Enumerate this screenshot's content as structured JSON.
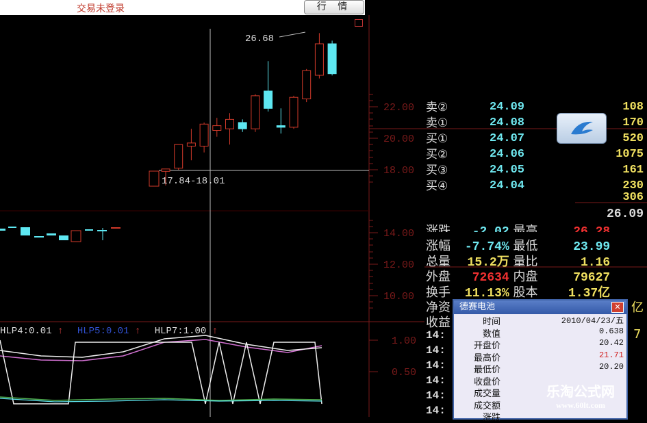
{
  "topbar": {
    "title": "交易未登录",
    "market_button": "行 情"
  },
  "price_chart": {
    "high_annotation": "26.68",
    "range_annotation": "17.84-18.01",
    "y_axis": [
      "22.00",
      "20.00",
      "18.00",
      "14.00",
      "12.00",
      "10.00"
    ],
    "candles": [
      {
        "o": 17.9,
        "c": 18.05,
        "h": 18.05,
        "l": 17.0
      },
      {
        "o": 18.1,
        "c": 19.6,
        "h": 19.6,
        "l": 18.0
      },
      {
        "o": 19.5,
        "c": 19.7,
        "h": 20.6,
        "l": 18.6
      },
      {
        "o": 19.5,
        "c": 20.9,
        "h": 21.0,
        "l": 19.1
      },
      {
        "o": 20.5,
        "c": 20.8,
        "h": 21.3,
        "l": 20.1
      },
      {
        "o": 20.6,
        "c": 21.2,
        "h": 21.6,
        "l": 19.6
      },
      {
        "o": 21.0,
        "c": 20.6,
        "h": 21.2,
        "l": 20.4
      },
      {
        "o": 20.6,
        "c": 22.7,
        "h": 22.8,
        "l": 20.4
      },
      {
        "o": 23.0,
        "c": 21.9,
        "h": 24.9,
        "l": 21.7
      },
      {
        "o": 20.8,
        "c": 20.7,
        "h": 21.9,
        "l": 20.3
      },
      {
        "o": 20.7,
        "c": 22.6,
        "h": 22.7,
        "l": 20.6
      },
      {
        "o": 22.5,
        "c": 24.3,
        "h": 24.4,
        "l": 22.3
      },
      {
        "o": 24.0,
        "c": 26.0,
        "h": 26.68,
        "l": 23.8
      },
      {
        "o": 26.0,
        "c": 24.1,
        "h": 26.2,
        "l": 23.99
      }
    ]
  },
  "order_book": [
    {
      "label": "卖②",
      "price": "24.09",
      "vol": "108"
    },
    {
      "label": "卖①",
      "price": "24.08",
      "vol": "170"
    },
    {
      "label": "买①",
      "price": "24.07",
      "vol": "520"
    },
    {
      "label": "买②",
      "price": "24.06",
      "vol": "1075"
    },
    {
      "label": "买③",
      "price": "24.05",
      "vol": "161"
    },
    {
      "label": "买④",
      "price": "24.04",
      "vol": "230"
    }
  ],
  "extra_vol": "306",
  "stats": {
    "current": "26.09",
    "row1": {
      "l1": "涨跌",
      "v1": "-2.02",
      "l2": "最高",
      "v2": "26.28"
    },
    "row2": {
      "l1": "涨幅",
      "v1": "-7.74%",
      "l2": "最低",
      "v2": "23.99"
    },
    "row3": {
      "l1": "总量",
      "v1": "15.2万",
      "l2": "量比",
      "v2": "1.16"
    },
    "row4": {
      "l1": "外盘",
      "v1": "72634",
      "l2": "内盘",
      "v2": "79627"
    },
    "row5": {
      "l1": "换手",
      "v1": "11.13%",
      "l2": "股本",
      "v2": "1.37亿"
    },
    "row6_label": "净资",
    "row6_val": "亿",
    "row7_label": "收益",
    "row7_val": "7"
  },
  "time_col": [
    "14:",
    "14:",
    "14:",
    "14:",
    "14:",
    "14:"
  ],
  "indicator": {
    "hlp4": "HLP4:0.01",
    "hlp5": "HLP5:0.01",
    "hlp7": "HLP7:1.00",
    "arrow": "↑",
    "y_axis": [
      "1.00",
      "0.50"
    ]
  },
  "popup": {
    "title": "德赛电池",
    "close": "✕",
    "rows": [
      {
        "label": "时间",
        "value": "2010/04/23/五"
      },
      {
        "label": "数值",
        "value": "0.638"
      },
      {
        "label": "开盘价",
        "value": "20.42"
      },
      {
        "label": "最高价",
        "value": "21.71"
      },
      {
        "label": "最低价",
        "value": "20.20"
      },
      {
        "label": "收盘价",
        "value": ""
      },
      {
        "label": "成交量",
        "value": ""
      },
      {
        "label": "成交额",
        "value": ""
      },
      {
        "label": "涨跌",
        "value": ""
      }
    ]
  },
  "watermark": {
    "line1": "乐淘公式网",
    "line2": "www.60lt.com"
  },
  "colors": {
    "up": "#d23a2a",
    "down": "#5ee8f2",
    "axis": "#7a1a1a",
    "crosshair": "#bbbbbb"
  }
}
